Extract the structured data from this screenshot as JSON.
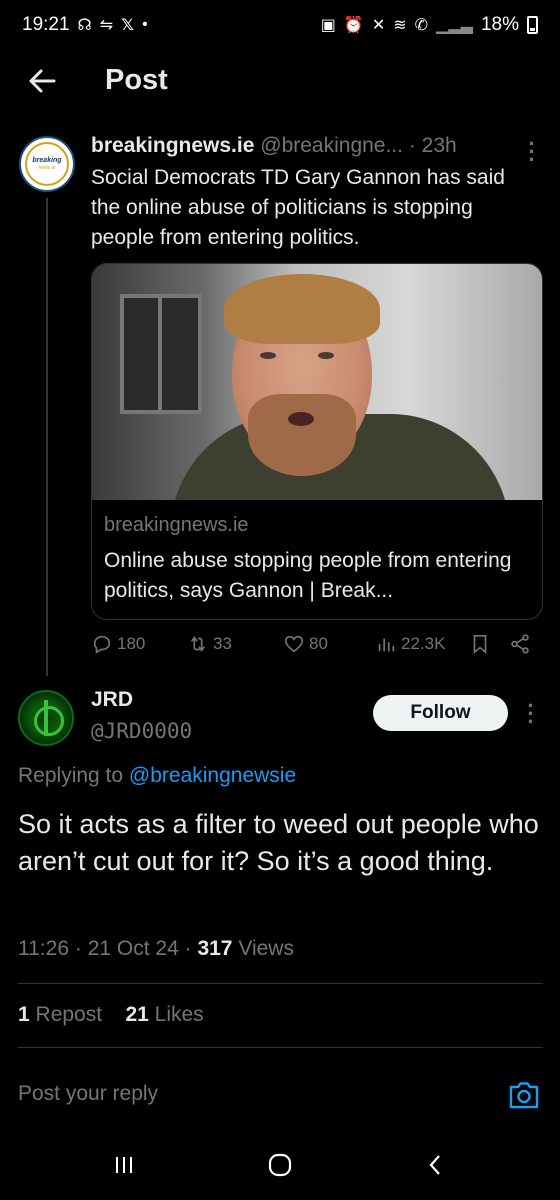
{
  "status_bar": {
    "time": "19:21",
    "left_icons": [
      "signal-icon",
      "data-icon",
      "x-icon",
      "dot-icon"
    ],
    "battery": "18%",
    "right_icons": [
      "lock-icon",
      "alarm-icon",
      "mute-icon",
      "wifi-icon",
      "call-icon",
      "signal-bars-icon",
      "battery-icon"
    ]
  },
  "header": {
    "title": "Post"
  },
  "original_post": {
    "display_name": "breakingnews.ie",
    "handle": "@breakingne...",
    "time": "· 23h",
    "text": "Social Democrats TD Gary Gannon has said the online abuse of politicians is stopping people from entering politics.",
    "avatar_logo_text": "breaking news.ie",
    "card": {
      "domain": "breakingnews.ie",
      "title": "Online abuse stopping people from entering politics, says Gannon | Break..."
    },
    "actions": {
      "replies": "180",
      "reposts": "33",
      "likes": "80",
      "views": "22.3K"
    }
  },
  "reply_post": {
    "display_name": "JRD",
    "handle": "@JRD0000",
    "follow_label": "Follow",
    "replying_prefix": "Replying to",
    "replying_to": "@breakingnewsie",
    "text": "So it acts as a filter to weed out people who aren’t cut out for it? So it’s a good thing.",
    "time": "11:26",
    "date": "21 Oct 24",
    "views_count": "317",
    "views_label": "Views",
    "reposts_count": "1",
    "reposts_label": "Repost",
    "likes_count": "21",
    "likes_label": "Likes"
  },
  "composer": {
    "placeholder": "Post your reply"
  },
  "colors": {
    "background": "#000000",
    "accent": "#1d9bf0",
    "secondary_text": "#71767b",
    "primary_text": "#e7e9ea"
  }
}
